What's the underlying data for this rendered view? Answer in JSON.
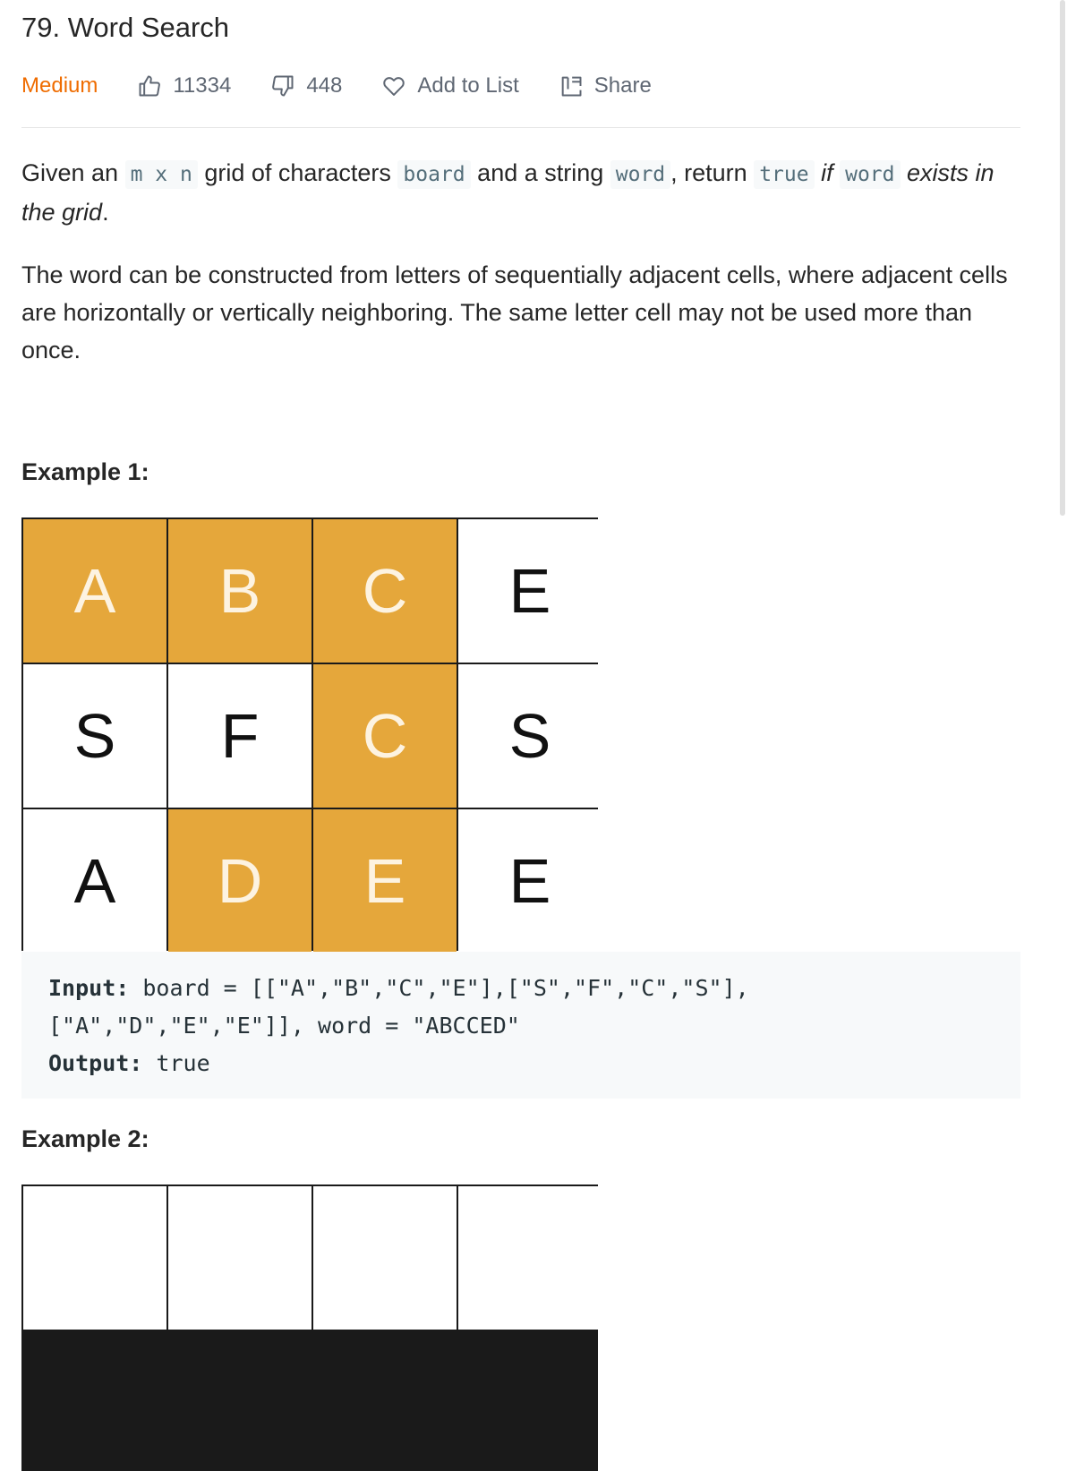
{
  "problem": {
    "title": "79. Word Search",
    "difficulty": "Medium",
    "likes": "11334",
    "dislikes": "448",
    "add_to_list_label": "Add to List",
    "share_label": "Share"
  },
  "description": {
    "p1_given": "Given an ",
    "p1_mxn": "m x n",
    "p1_grid": " grid of characters ",
    "p1_board": "board",
    "p1_and": " and a string ",
    "p1_word": "word",
    "p1_return": ", return ",
    "p1_true": "true",
    "p1_if": " if ",
    "p1_word2": "word",
    "p1_exists": " exists in the grid",
    "p1_period": ".",
    "p2": "The word can be constructed from letters of sequentially adjacent cells, where adjacent cells are horizontally or vertically neighboring. The same letter cell may not be used more than once."
  },
  "example1": {
    "title": "Example 1:",
    "grid": [
      [
        {
          "ch": "A",
          "hl": true
        },
        {
          "ch": "B",
          "hl": true
        },
        {
          "ch": "C",
          "hl": true
        },
        {
          "ch": "E",
          "hl": false
        }
      ],
      [
        {
          "ch": "S",
          "hl": false
        },
        {
          "ch": "F",
          "hl": false
        },
        {
          "ch": "C",
          "hl": true
        },
        {
          "ch": "S",
          "hl": false
        }
      ],
      [
        {
          "ch": "A",
          "hl": false
        },
        {
          "ch": "D",
          "hl": true
        },
        {
          "ch": "E",
          "hl": true
        },
        {
          "ch": "E",
          "hl": false
        }
      ]
    ],
    "input_label": "Input:",
    "input_line1": " board = [[\"A\",\"B\",\"C\",\"E\"],[\"S\",\"F\",\"C\",\"S\"],",
    "input_line2": "[\"A\",\"D\",\"E\",\"E\"]], word = \"ABCCED\"",
    "output_label": "Output:",
    "output_value": " true"
  },
  "example2": {
    "title": "Example 2:"
  },
  "colors": {
    "difficulty_medium": "#ef6c00",
    "highlight_cell": "#e5a73b",
    "code_bg": "#f7f9fa"
  },
  "icons": {
    "like": "thumbs-up-icon",
    "dislike": "thumbs-down-icon",
    "add_to_list": "heart-icon",
    "share": "share-icon"
  }
}
